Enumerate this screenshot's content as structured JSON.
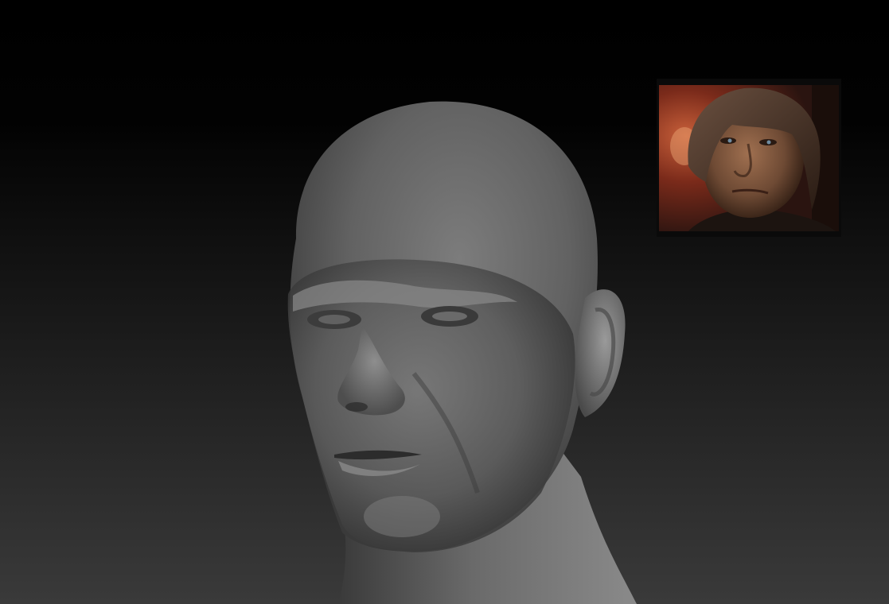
{
  "viewport": {
    "background_top_color": "#000000",
    "background_bottom_color": "#3a3a3a",
    "mesh_material_color": "#6e6e6e",
    "mesh_highlight_color": "#9a9a9a",
    "mesh_shadow_color": "#262626"
  },
  "sculpt": {
    "subject": "bald-male-head-bust"
  },
  "reference_image": {
    "subject": "man-with-brown-hair-photo",
    "frame_color": "#0a0a0a",
    "skin_color": "#6e4a34",
    "hair_color": "#3a2a1e",
    "background_warm_color": "#7a2a1a"
  }
}
